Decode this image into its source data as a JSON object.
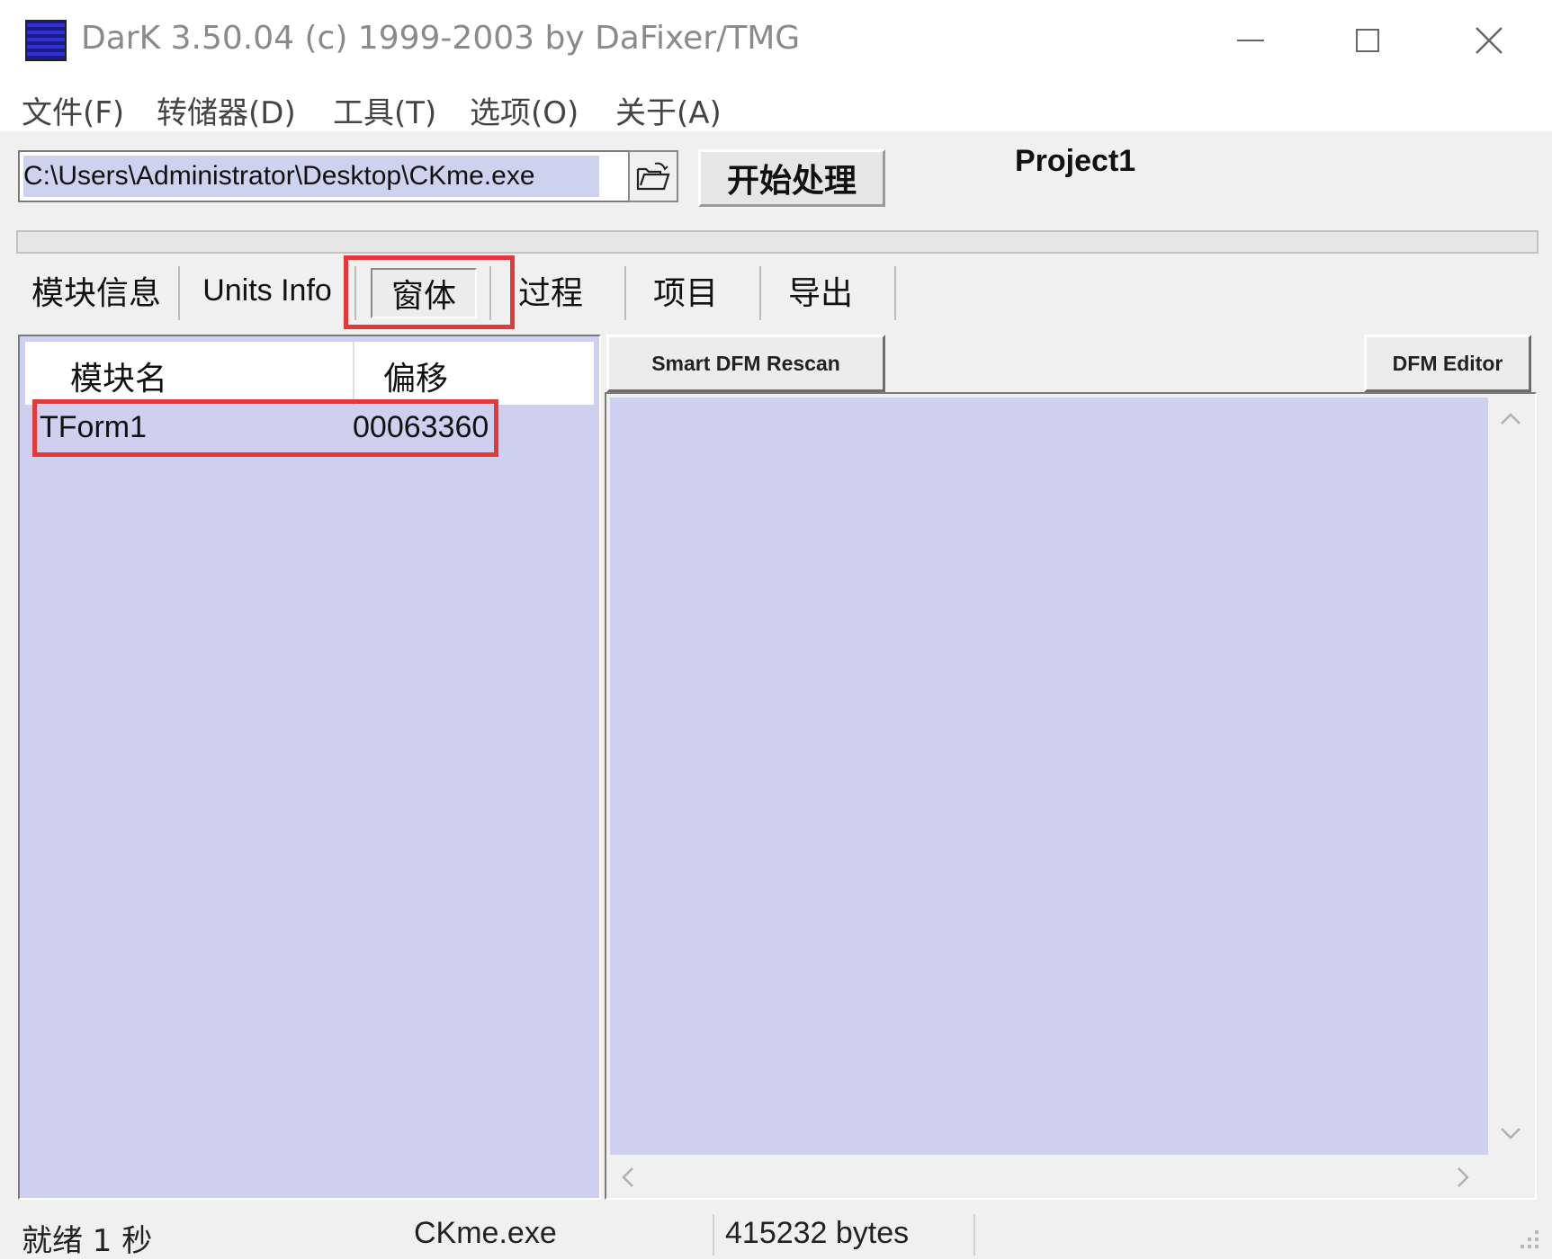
{
  "window": {
    "title": "DarK 3.50.04 (c) 1999-2003 by DaFixer/TMG"
  },
  "menu": {
    "items": [
      "文件(F)",
      "转储器(D)",
      "工具(T)",
      "选项(O)",
      "关于(A)"
    ]
  },
  "toolbar": {
    "path_value": "C:\\Users\\Administrator\\Desktop\\CKme.exe",
    "start_label": "开始处理",
    "project_name": "Project1"
  },
  "tabs": [
    {
      "label": "模块信息"
    },
    {
      "label": "Units Info"
    },
    {
      "label": "窗体",
      "active": true
    },
    {
      "label": "过程"
    },
    {
      "label": "项目"
    },
    {
      "label": "导出"
    }
  ],
  "forms_list": {
    "columns": [
      "模块名",
      "偏移"
    ],
    "rows": [
      {
        "name": "TForm1",
        "offset": "00063360"
      }
    ]
  },
  "dfm_panel": {
    "rescan_label": "Smart DFM Rescan",
    "editor_label": "DFM Editor"
  },
  "status": {
    "state": "就绪 1 秒",
    "file": "CKme.exe",
    "size": "415232 bytes"
  },
  "colors": {
    "list_background": "#cdd0ee",
    "highlight_box": "#e53939"
  },
  "icons": {
    "app": "dark-app-icon",
    "open": "open-folder-icon",
    "dropdown": "chevron-down-icon"
  }
}
